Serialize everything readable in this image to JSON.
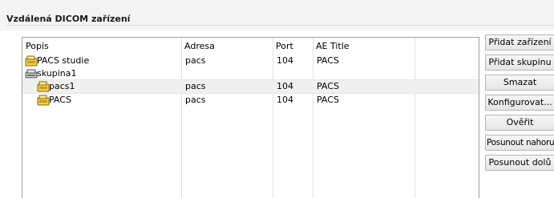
{
  "panel": {
    "title": "Vzdálená DICOM zařízení"
  },
  "table": {
    "columns": [
      "Popis",
      "Adresa",
      "Port",
      "AE Title"
    ],
    "rows": [
      {
        "name": "PACS studie",
        "address": "pacs",
        "port": "104",
        "ae_title": "PACS",
        "icon": "dicom-node-icon"
      },
      {
        "name": "skupina1",
        "address": "",
        "port": "",
        "ae_title": "",
        "icon": "group-icon"
      },
      {
        "name": "pacs1",
        "address": "pacs",
        "port": "104",
        "ae_title": "PACS",
        "icon": "dicom-node-icon",
        "selected": true
      },
      {
        "name": "PACS",
        "address": "pacs",
        "port": "104",
        "ae_title": "PACS",
        "icon": "dicom-node-icon"
      }
    ]
  },
  "buttons": {
    "add_device": "Přidat zařízení",
    "add_group": "Přidat skupinu",
    "delete": "Smazat",
    "configure": "Konfigurovat...",
    "verify": "Ověřit",
    "move_up": "Posunout nahoru",
    "move_down": "Posunout dolů"
  }
}
